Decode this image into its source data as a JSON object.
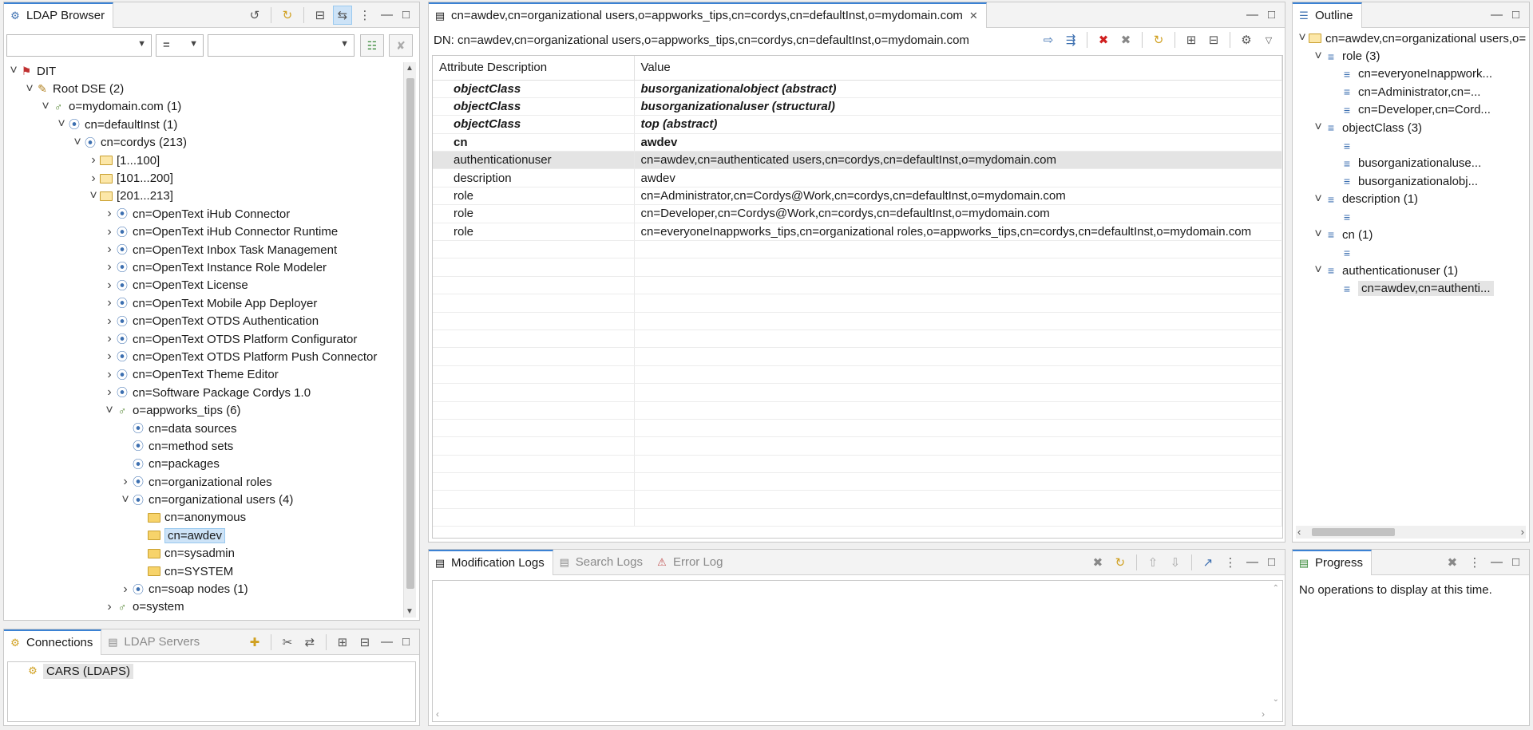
{
  "ldap_browser": {
    "tab_label": "LDAP Browser",
    "filter_operator": "=",
    "tree": [
      {
        "label": "DIT",
        "indent": 0,
        "arrow": "v",
        "icon": "dit"
      },
      {
        "label": "Root DSE (2)",
        "indent": 1,
        "arrow": "v",
        "icon": "rootdse"
      },
      {
        "label": "o=mydomain.com (1)",
        "indent": 2,
        "arrow": "v",
        "icon": "org"
      },
      {
        "label": "cn=defaultInst (1)",
        "indent": 3,
        "arrow": "v",
        "icon": "entry"
      },
      {
        "label": "cn=cordys (213)",
        "indent": 4,
        "arrow": "v",
        "icon": "entry"
      },
      {
        "label": "[1...100]",
        "indent": 5,
        "arrow": ">",
        "icon": "folder-open"
      },
      {
        "label": "[101...200]",
        "indent": 5,
        "arrow": ">",
        "icon": "folder-open"
      },
      {
        "label": "[201...213]",
        "indent": 5,
        "arrow": "v",
        "icon": "folder-open"
      },
      {
        "label": "cn=OpenText iHub Connector",
        "indent": 6,
        "arrow": ">",
        "icon": "entry"
      },
      {
        "label": "cn=OpenText iHub Connector Runtime",
        "indent": 6,
        "arrow": ">",
        "icon": "entry"
      },
      {
        "label": "cn=OpenText Inbox Task Management",
        "indent": 6,
        "arrow": ">",
        "icon": "entry"
      },
      {
        "label": "cn=OpenText Instance Role Modeler",
        "indent": 6,
        "arrow": ">",
        "icon": "entry"
      },
      {
        "label": "cn=OpenText License",
        "indent": 6,
        "arrow": ">",
        "icon": "entry"
      },
      {
        "label": "cn=OpenText Mobile App Deployer",
        "indent": 6,
        "arrow": ">",
        "icon": "entry"
      },
      {
        "label": "cn=OpenText OTDS Authentication",
        "indent": 6,
        "arrow": ">",
        "icon": "entry"
      },
      {
        "label": "cn=OpenText OTDS Platform Configurator",
        "indent": 6,
        "arrow": ">",
        "icon": "entry"
      },
      {
        "label": "cn=OpenText OTDS Platform Push Connector",
        "indent": 6,
        "arrow": ">",
        "icon": "entry"
      },
      {
        "label": "cn=OpenText Theme Editor",
        "indent": 6,
        "arrow": ">",
        "icon": "entry"
      },
      {
        "label": "cn=Software Package Cordys 1.0",
        "indent": 6,
        "arrow": ">",
        "icon": "entry"
      },
      {
        "label": "o=appworks_tips (6)",
        "indent": 6,
        "arrow": "v",
        "icon": "org"
      },
      {
        "label": "cn=data sources",
        "indent": 7,
        "arrow": "",
        "icon": "entry"
      },
      {
        "label": "cn=method sets",
        "indent": 7,
        "arrow": "",
        "icon": "entry"
      },
      {
        "label": "cn=packages",
        "indent": 7,
        "arrow": "",
        "icon": "entry"
      },
      {
        "label": "cn=organizational roles",
        "indent": 7,
        "arrow": ">",
        "icon": "entry"
      },
      {
        "label": "cn=organizational users (4)",
        "indent": 7,
        "arrow": "v",
        "icon": "entry"
      },
      {
        "label": "cn=anonymous",
        "indent": 8,
        "arrow": "",
        "icon": "folder"
      },
      {
        "label": "cn=awdev",
        "indent": 8,
        "arrow": "",
        "icon": "folder",
        "selected": true
      },
      {
        "label": "cn=sysadmin",
        "indent": 8,
        "arrow": "",
        "icon": "folder"
      },
      {
        "label": "cn=SYSTEM",
        "indent": 8,
        "arrow": "",
        "icon": "folder"
      },
      {
        "label": "cn=soap nodes (1)",
        "indent": 7,
        "arrow": ">",
        "icon": "entry"
      },
      {
        "label": "o=system",
        "indent": 6,
        "arrow": ">",
        "icon": "org"
      }
    ]
  },
  "connections": {
    "tab_label": "Connections",
    "tab2_label": "LDAP Servers",
    "items": [
      "CARS (LDAPS)"
    ]
  },
  "editor": {
    "tab_label": "cn=awdev,cn=organizational users,o=appworks_tips,cn=cordys,cn=defaultInst,o=mydomain.com",
    "dn_line": "DN: cn=awdev,cn=organizational users,o=appworks_tips,cn=cordys,cn=defaultInst,o=mydomain.com",
    "col_desc": "Attribute Description",
    "col_value": "Value",
    "rows": [
      {
        "desc": "objectClass",
        "value": "busorganizationalobject (abstract)",
        "style": "bi"
      },
      {
        "desc": "objectClass",
        "value": "busorganizationaluser (structural)",
        "style": "bi"
      },
      {
        "desc": "objectClass",
        "value": "top (abstract)",
        "style": "bi"
      },
      {
        "desc": "cn",
        "value": "awdev",
        "style": "b"
      },
      {
        "desc": "authenticationuser",
        "value": "cn=awdev,cn=authenticated users,cn=cordys,cn=defaultInst,o=mydomain.com",
        "style": "hl"
      },
      {
        "desc": "description",
        "value": "awdev",
        "style": ""
      },
      {
        "desc": "role",
        "value": "cn=Administrator,cn=Cordys@Work,cn=cordys,cn=defaultInst,o=mydomain.com",
        "style": ""
      },
      {
        "desc": "role",
        "value": "cn=Developer,cn=Cordys@Work,cn=cordys,cn=defaultInst,o=mydomain.com",
        "style": ""
      },
      {
        "desc": "role",
        "value": "cn=everyoneInappworks_tips,cn=organizational roles,o=appworks_tips,cn=cordys,cn=defaultInst,o=mydomain.com",
        "style": ""
      }
    ],
    "empty_rows": 16
  },
  "logs": {
    "tab_modification": "Modification Logs",
    "tab_search": "Search Logs",
    "tab_error": "Error Log"
  },
  "outline": {
    "tab_label": "Outline",
    "items": [
      {
        "label": "cn=awdev,cn=organizational users,o=",
        "indent": 0,
        "arrow": "v",
        "icon": "folder"
      },
      {
        "label": "role (3)",
        "indent": 1,
        "arrow": "v",
        "icon": "lines"
      },
      {
        "label": "cn=everyoneInappwork...",
        "indent": 2,
        "arrow": "",
        "icon": "lines"
      },
      {
        "label": "cn=Administrator,cn=...",
        "indent": 2,
        "arrow": "",
        "icon": "lines"
      },
      {
        "label": "cn=Developer,cn=Cord...",
        "indent": 2,
        "arrow": "",
        "icon": "lines"
      },
      {
        "label": "objectClass (3)",
        "indent": 1,
        "arrow": "v",
        "icon": "lines"
      },
      {
        "label": "",
        "indent": 2,
        "arrow": "",
        "icon": "lines"
      },
      {
        "label": "busorganizationaluse...",
        "indent": 2,
        "arrow": "",
        "icon": "lines"
      },
      {
        "label": "busorganizationalobj...",
        "indent": 2,
        "arrow": "",
        "icon": "lines"
      },
      {
        "label": "description (1)",
        "indent": 1,
        "arrow": "v",
        "icon": "lines"
      },
      {
        "label": "",
        "indent": 2,
        "arrow": "",
        "icon": "lines"
      },
      {
        "label": "cn (1)",
        "indent": 1,
        "arrow": "v",
        "icon": "lines"
      },
      {
        "label": "",
        "indent": 2,
        "arrow": "",
        "icon": "lines"
      },
      {
        "label": "authenticationuser (1)",
        "indent": 1,
        "arrow": "v",
        "icon": "lines"
      },
      {
        "label": "cn=awdev,cn=authenti...",
        "indent": 2,
        "arrow": "",
        "icon": "lines",
        "selected": true
      }
    ]
  },
  "progress": {
    "tab_label": "Progress",
    "message": "No operations to display at this time."
  }
}
